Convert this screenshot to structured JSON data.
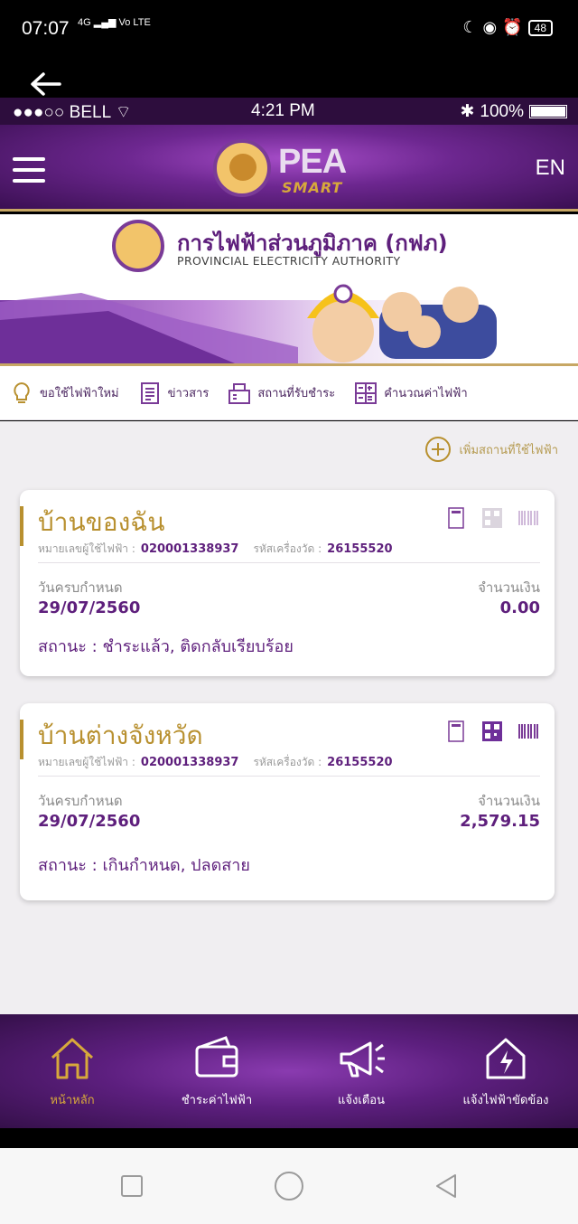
{
  "android_status": {
    "time": "07:07",
    "network": "4G",
    "volte": "Vo LTE",
    "battery": "48"
  },
  "ios_status": {
    "carrier": "●●●○○ BELL",
    "time": "4:21 PM",
    "battery": "100%"
  },
  "header": {
    "brand_title": "PEA",
    "brand_sub": "SMART",
    "lang": "EN"
  },
  "banner": {
    "org_name_th": "การไฟฟ้าส่วนภูมิภาค (กฟภ)",
    "org_name_en": "PROVINCIAL ELECTRICITY AUTHORITY"
  },
  "quick_menu": [
    {
      "label": "ขอใช้ไฟฟ้าใหม่",
      "icon": "lightbulb-icon"
    },
    {
      "label": "ข่าวสาร",
      "icon": "news-icon"
    },
    {
      "label": "สถานที่รับชำระ",
      "icon": "payment-counter-icon"
    },
    {
      "label": "คำนวณค่าไฟฟ้า",
      "icon": "calculator-icon"
    }
  ],
  "add_location": "เพิ่มสถานที่ใช้ไฟฟ้า",
  "cards": [
    {
      "title": "บ้านของฉัน",
      "account_label": "หมายเลขผู้ใช้ไฟฟ้า :",
      "account_no": "020001338937",
      "meter_label": "รหัสเครื่องวัด :",
      "meter_no": "26155520",
      "due_label": "วันครบกำหนด",
      "due_date": "29/07/2560",
      "amount_label": "จำนวนเงิน",
      "amount": "0.00",
      "status": "สถานะ : ชำระแล้ว, ติดกลับเรียบร้อย"
    },
    {
      "title": "บ้านต่างจังหวัด",
      "account_label": "หมายเลขผู้ใช้ไฟฟ้า :",
      "account_no": "020001338937",
      "meter_label": "รหัสเครื่องวัด :",
      "meter_no": "26155520",
      "due_label": "วันครบกำหนด",
      "due_date": "29/07/2560",
      "amount_label": "จำนวนเงิน",
      "amount": "2,579.15",
      "status": "สถานะ : เกินกำหนด, ปลดสาย"
    }
  ],
  "bottom_nav": [
    {
      "label": "หน้าหลัก",
      "icon": "home-icon"
    },
    {
      "label": "ชำระค่าไฟฟ้า",
      "icon": "wallet-icon"
    },
    {
      "label": "แจ้งเตือน",
      "icon": "megaphone-icon"
    },
    {
      "label": "แจ้งไฟฟ้าขัดข้อง",
      "icon": "outage-house-icon"
    }
  ],
  "colors": {
    "brand_purple": "#5e1f7c",
    "gold": "#b8902f",
    "background": "#f0eef1"
  }
}
